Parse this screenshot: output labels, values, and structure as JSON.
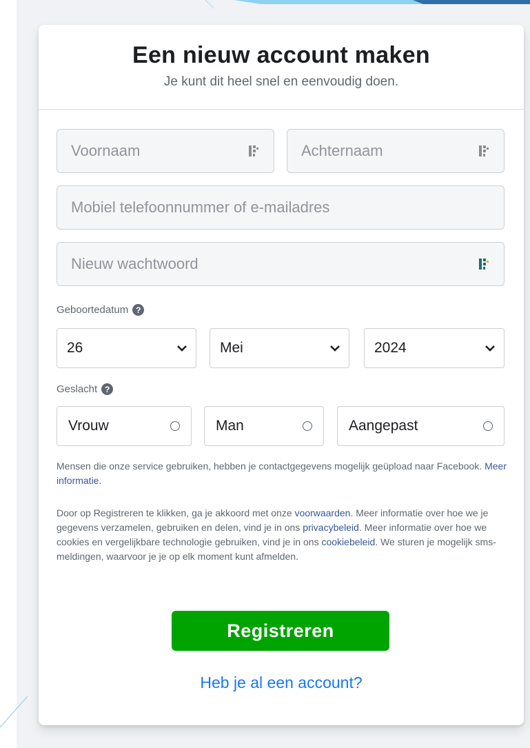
{
  "colors": {
    "accent_green": "#00a400",
    "link_blue": "#1877f2",
    "text_link": "#385898",
    "background": "#f0f2f5"
  },
  "header": {
    "title": "Een nieuw account maken",
    "subtitle": "Je kunt dit heel snel en eenvoudig doen."
  },
  "form": {
    "first_name": {
      "placeholder": "Voornaam",
      "value": ""
    },
    "last_name": {
      "placeholder": "Achternaam",
      "value": ""
    },
    "contact": {
      "placeholder": "Mobiel telefoonnummer of e-mailadres",
      "value": ""
    },
    "password": {
      "placeholder": "Nieuw wachtwoord",
      "value": ""
    },
    "birthday": {
      "label": "Geboortedatum",
      "help_icon": "?",
      "day": "26",
      "month": "Mei",
      "year": "2024"
    },
    "gender": {
      "label": "Geslacht",
      "help_icon": "?",
      "options": [
        "Vrouw",
        "Man",
        "Aangepast"
      ]
    }
  },
  "legal": {
    "contacts_notice": "Mensen die onze service gebruiken, hebben je contactgegevens mogelijk geüpload naar Facebook.",
    "contacts_link": "Meer informatie.",
    "terms_1": "Door op Registreren te klikken, ga je akkoord met onze ",
    "terms_link": "voorwaarden",
    "terms_2": ". Meer informatie over hoe we je gegevens verzamelen, gebruiken en delen, vind je in ons ",
    "privacy_link": "privacybeleid",
    "terms_3": ". Meer informatie over hoe we cookies en vergelijkbare technologie gebruiken, vind je in ons ",
    "cookie_link": "cookiebeleid",
    "terms_4": ". We sturen je mogelijk sms-meldingen, waarvoor je je op elk moment kunt afmelden."
  },
  "actions": {
    "register_label": "Registreren",
    "login_link": "Heb je al een account?"
  },
  "icons": {
    "password_manager": "password-manager-icon",
    "dropdown": "chevron-down-icon",
    "help": "help-circle-icon",
    "radio": "radio-button-icon"
  }
}
